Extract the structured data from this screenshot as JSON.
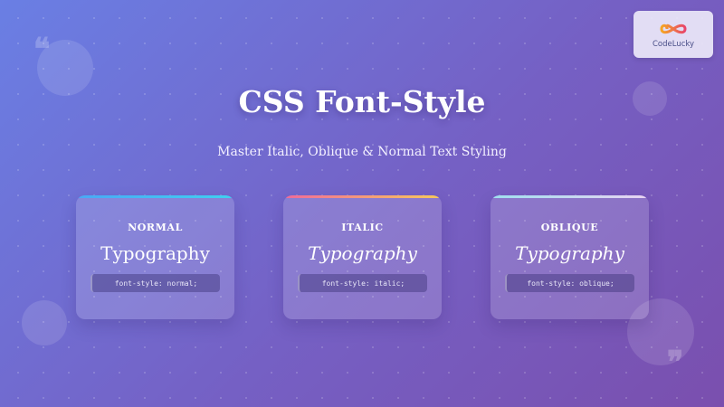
{
  "brand": {
    "name": "CodeLucky"
  },
  "header": {
    "title": "CSS Font-Style",
    "subtitle": "Master Italic, Oblique & Normal Text Styling"
  },
  "decor": {
    "quote_open": "❝",
    "quote_close": "❞"
  },
  "cards": [
    {
      "label": "NORMAL",
      "sample": "Typography",
      "code": "font-style: normal;",
      "style": "normal",
      "accent": [
        "#4aa8f5",
        "#3fd0f0"
      ]
    },
    {
      "label": "ITALIC",
      "sample": "Typography",
      "code": "font-style: italic;",
      "style": "italic",
      "accent": [
        "#f06a9a",
        "#f7c95a"
      ]
    },
    {
      "label": "OBLIQUE",
      "sample": "Typography",
      "code": "font-style: oblique;",
      "style": "oblique",
      "accent": [
        "#9fe0ef",
        "#e9d3f2"
      ]
    }
  ]
}
